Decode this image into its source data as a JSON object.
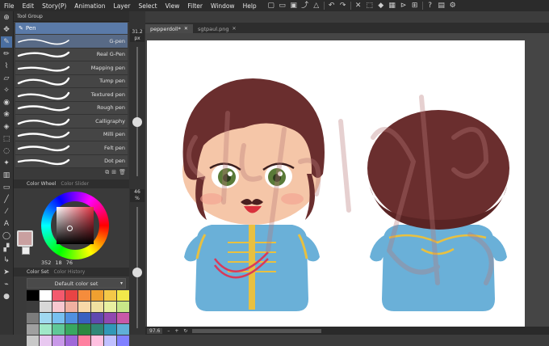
{
  "menubar": {
    "items": [
      "File",
      "Edit",
      "Story(P)",
      "Animation",
      "Layer",
      "Select",
      "View",
      "Filter",
      "Window",
      "Help"
    ]
  },
  "tool_group": {
    "tab_label": "Tool Group",
    "header_label": "Pen",
    "brushes": [
      "G-pen",
      "Real G-Pen",
      "Mapping pen",
      "Tump pen",
      "Textured pen",
      "Rough pen",
      "Calligraphy",
      "Milli pen",
      "Felt pen",
      "Dot pen"
    ],
    "selected_index": 0
  },
  "color_wheel": {
    "tab_label": "Color Wheel",
    "tab2_label": "Color Slider",
    "values": [
      "352",
      "18",
      "76"
    ],
    "main_color": "#c9a0a0"
  },
  "color_set": {
    "tab_label": "Color Set",
    "tab2_label": "Color History",
    "set_name": "Default color set",
    "swatches": [
      "#000000",
      "#ffffff",
      "#f35a6e",
      "#e84444",
      "#f58c3c",
      "#f0a030",
      "#f4c848",
      "#f2e84a",
      "#3c3c3c",
      "#d8d8d8",
      "#f8c8d0",
      "#f0b0a0",
      "#f8d8a8",
      "#f0e0a0",
      "#e8f0a0",
      "#c8e888",
      "#7c7c7c",
      "#a0d8f0",
      "#78c0f0",
      "#5090e0",
      "#3860c0",
      "#6048b0",
      "#9048b0",
      "#c858a8",
      "#a0a0a0",
      "#a0e8c8",
      "#60c898",
      "#38a860",
      "#2c8840",
      "#308878",
      "#3098b8",
      "#60b0d8",
      "#c8c8c8",
      "#e8c8f0",
      "#c898e8",
      "#a068d8",
      "#ff80a0",
      "#ffc0e0",
      "#c0c0ff",
      "#8080ff"
    ]
  },
  "brush_size": {
    "value": "31.2",
    "unit": "px",
    "level": 0.42
  },
  "opacity": {
    "value": "46",
    "unit": "%",
    "level": 0.46
  },
  "document_tabs": [
    {
      "label": "pepperdoll*",
      "active": true
    },
    {
      "label": "sgtpaul.png",
      "active": false
    }
  ],
  "status": {
    "zoom": "97.6"
  },
  "colors": {
    "accent": "#5a7aa8",
    "panel": "#3a3a3a",
    "menubar": "#2b2b2b"
  }
}
